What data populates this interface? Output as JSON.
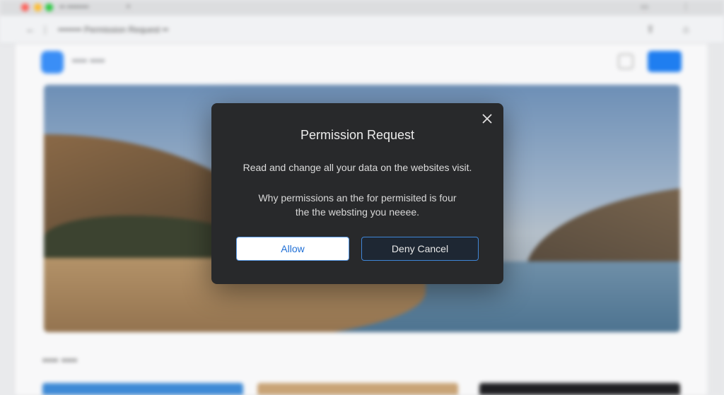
{
  "browser": {
    "tab_title": "•• ••••••••",
    "address_text": "•••••••• Permission Request ••",
    "site_name": "•••• ••••",
    "section_title": "•••• ••••",
    "accent_color": "#1f7ef0"
  },
  "dialog": {
    "title": "Permission Request",
    "description": "Read and change all your data on the websites visit.",
    "subtext": "Why permissions an the for permisited is four the the websting you neeee.",
    "allow_label": "Allow",
    "deny_label": "Deny Cancel",
    "close_icon": "close-icon"
  }
}
